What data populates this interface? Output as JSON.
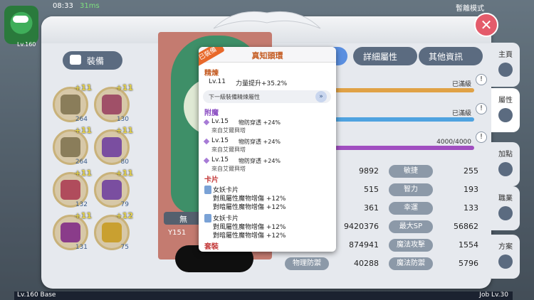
{
  "status": {
    "time": "08:33",
    "ms": "31ms",
    "top_right_label": "暫離模式"
  },
  "player": {
    "level": "Lv.160"
  },
  "panel": {
    "equip_tab_label": "裝備",
    "tabs": [
      {
        "label": "",
        "active": true
      },
      {
        "label": "詳細屬性",
        "active": false
      },
      {
        "label": "其他資訊",
        "active": false
      }
    ],
    "char_code": "Y151",
    "char_name_partial": "無"
  },
  "equipment_slots": [
    {
      "plus": "+11",
      "num": "264",
      "color": "#8a7d5a"
    },
    {
      "plus": "+11",
      "num": "130",
      "color": "#a05068"
    },
    {
      "plus": "+11",
      "num": "264",
      "color": "#8a7d5a"
    },
    {
      "plus": "+11",
      "num": "80",
      "color": "#7a4ea0"
    },
    {
      "plus": "+11",
      "num": "132",
      "color": "#b04c5c"
    },
    {
      "plus": "+11",
      "num": "79",
      "color": "#7a4ea0"
    },
    {
      "plus": "+11",
      "num": "131",
      "color": "#8a3c8a"
    },
    {
      "plus": "+12",
      "num": "75",
      "color": "#c9a030"
    }
  ],
  "bars": [
    {
      "value": "已滿級",
      "fill": 1.0,
      "color": "#e0a246"
    },
    {
      "value": "已滿級",
      "fill": 1.0,
      "color": "#4fa3e0"
    },
    {
      "value": "4000/4000",
      "fill": 1.0,
      "color": "#a04ec0"
    }
  ],
  "info_icon": "!",
  "stats": [
    {
      "left_val": "9892",
      "label": "敏捷",
      "right_val": "255"
    },
    {
      "left_val": "515",
      "label": "智力",
      "right_val": "193"
    },
    {
      "left_val": "361",
      "label": "幸運",
      "right_val": "133"
    },
    {
      "left_val": "9420376",
      "label": "最大SP",
      "right_val": "56862"
    },
    {
      "left_val": "874941",
      "label": "魔法攻擊",
      "right_val": "1554"
    },
    {
      "left_label": "物理防禦",
      "left_val": "40288",
      "label": "魔法防禦",
      "right_val": "5796"
    }
  ],
  "side_nav": [
    {
      "label": "主頁",
      "active": false
    },
    {
      "label": "屬性",
      "active": true
    },
    {
      "label": "加點",
      "active": false
    },
    {
      "label": "職業",
      "active": false
    },
    {
      "label": "方案",
      "active": false
    }
  ],
  "exp": {
    "base": "Lv.160 Base",
    "job": "Job Lv.30"
  },
  "popup": {
    "equipped_tag": "已裝備",
    "title": "真知頭環",
    "refine": {
      "section": "精煉",
      "level": "Lv.11",
      "effect": "力量提升+35.2%",
      "next_label": "下一級裝備精煉屬性",
      "next_arrow": "»"
    },
    "enchant": {
      "section": "附魔",
      "entries": [
        {
          "level": "Lv.15",
          "effect": "物防穿透 +24%",
          "source": "來自艾爾興塔"
        },
        {
          "level": "Lv.15",
          "effect": "物防穿透 +24%",
          "source": "來自艾爾興塔"
        },
        {
          "level": "Lv.15",
          "effect": "物防穿透 +24%",
          "source": "來自艾爾興塔"
        }
      ]
    },
    "cards": {
      "section": "卡片",
      "entries": [
        {
          "name": "女妖卡片",
          "line1": "對風屬性魔物增傷 +12%",
          "line2": "對暗屬性魔物增傷 +12%"
        },
        {
          "name": "女妖卡片",
          "line1": "對風屬性魔物增傷 +12%",
          "line2": "對暗屬性魔物增傷 +12%"
        }
      ]
    },
    "set": {
      "section": "套裝"
    }
  }
}
